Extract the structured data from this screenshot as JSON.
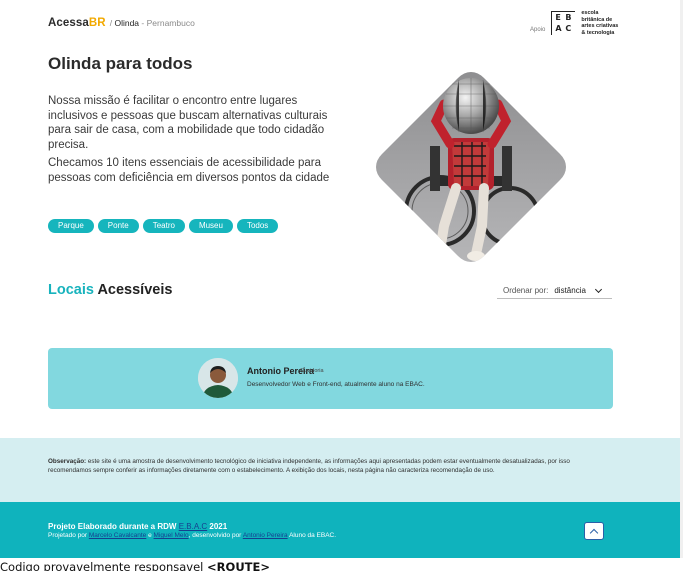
{
  "header": {
    "brand_main": "Acessa",
    "brand_accent": "BR",
    "crumb_sep": "/",
    "crumb_city": "Olinda",
    "crumb_dash": "-",
    "crumb_state": "Pernambuco",
    "sponsor_label": "Apoio",
    "sponsor_logo_letters": [
      "E",
      "B",
      "A",
      "C"
    ],
    "sponsor_text": "escola britânica de artes criativas & tecnologia"
  },
  "hero": {
    "title": "Olinda para todos",
    "paragraph1": "Nossa missão é facilitar o encontro entre lugares inclusivos e pessoas que buscam alternativas culturais para sair de casa, com a mobilidade que todo cidadão precisa.",
    "paragraph2": "Checamos 10 itens essenciais de acessibilidade para pessoas com deficiência em diversos pontos da cidade",
    "filters": [
      "Parque",
      "Ponte",
      "Teatro",
      "Museu",
      "Todos"
    ]
  },
  "locais": {
    "title_accent": "Locais",
    "title_rest": "Acessíveis",
    "order_label": "Ordenar por:",
    "order_value": "distância"
  },
  "card": {
    "name": "Antonio Pereira",
    "role": "Ouvidoria",
    "description": "Desenvolvedor Web e Front-end, atualmente aluno na EBAC."
  },
  "note": {
    "label": "Observação:",
    "text": "este site é uma amostra de desenvolvimento tecnológico de iniciativa independente, as informações aqui apresentadas podem estar eventualmente desatualizadas, por isso recomendamos sempre conferir as informações diretamente com o estabelecimento. A exibição dos locais, nesta página não caracteriza recomendação de uso."
  },
  "footer": {
    "project_text": "Projeto Elaborado durante a RDW",
    "project_link": "E.B.A.C",
    "project_year": "2021",
    "designed_prefix": "Projetado por",
    "designer1": "Marcelo Cavalcante",
    "designed_and": "e",
    "designer2": "Miguel Melo",
    "developed_by": ", desenvolvido por",
    "developer": "Antonio Pereira",
    "developer_suffix": "Aluno da EBAC."
  },
  "overflow": {
    "text": "Codigo provavelmente responsavel ",
    "bold": "<ROUTE>"
  },
  "colors": {
    "teal": "#0fb3bd",
    "teal_light": "#82d8df",
    "note_bg": "#d5eef1",
    "brand_accent": "#f2a900"
  }
}
